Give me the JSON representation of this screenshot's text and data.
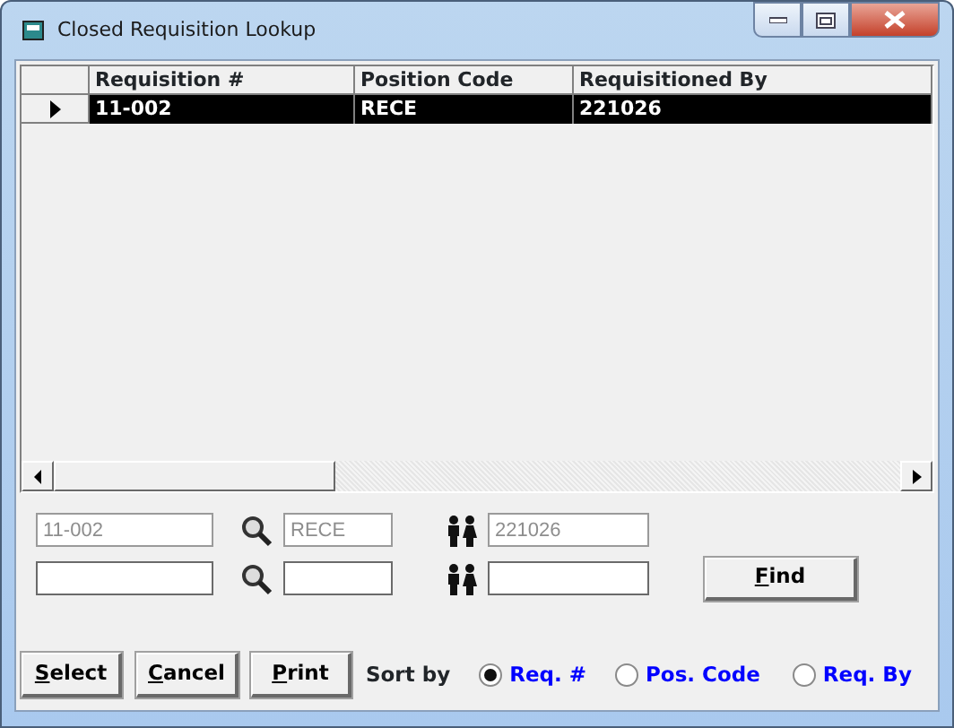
{
  "window": {
    "title": "Closed Requisition Lookup"
  },
  "grid": {
    "columns": [
      "Requisition #",
      "Position Code",
      "Requisitioned By"
    ],
    "rows": [
      {
        "cells": [
          "11-002",
          "RECE",
          "221026"
        ],
        "selected": true
      }
    ]
  },
  "search_rows": [
    {
      "fields": [
        {
          "value": "11-002",
          "disabled": true
        },
        {
          "value": "RECE",
          "disabled": true
        },
        {
          "value": "221026",
          "disabled": true
        }
      ]
    },
    {
      "fields": [
        {
          "disabled": false
        },
        {
          "disabled": false
        },
        {
          "disabled": false
        }
      ],
      "button": {
        "label": "Find",
        "underline_first": true
      }
    }
  ],
  "buttons": [
    {
      "label": "Select",
      "underline_first": true
    },
    {
      "label": "Cancel",
      "underline_first": true
    },
    {
      "label": "Print",
      "underline_first": true
    }
  ],
  "sort": {
    "label": "Sort by",
    "options": [
      {
        "label": "Req. #",
        "selected": true
      },
      {
        "label": "Pos. Code",
        "selected": false
      },
      {
        "label": "Req. By",
        "selected": false
      }
    ]
  }
}
